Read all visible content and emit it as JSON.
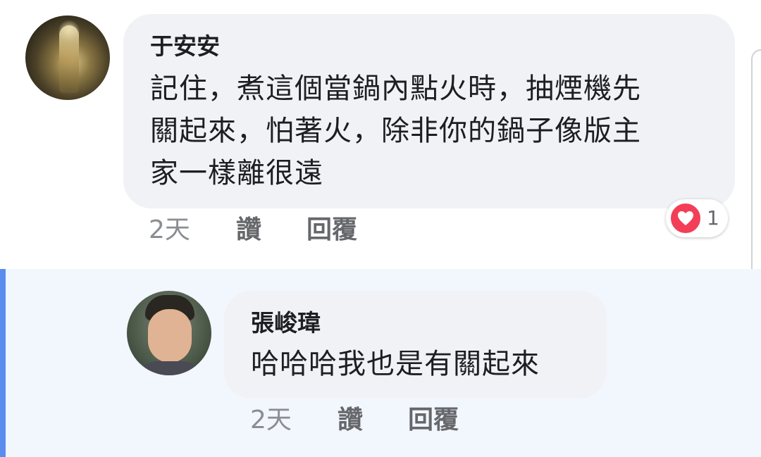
{
  "comments": [
    {
      "author": "于安安",
      "text_lines": [
        "記住，煮這個當鍋內點火時，抽煙機先",
        "關起來，怕著火，除非你的鍋子像版主",
        "家一樣離很遠"
      ],
      "time": "2天",
      "like_label": "讚",
      "reply_label": "回覆",
      "reaction": {
        "icon": "heart-icon",
        "color": "#f33e58",
        "count": "1"
      }
    },
    {
      "author": "張峻瑋",
      "text_lines": [
        "哈哈哈我也是有關起來"
      ],
      "time": "2天",
      "like_label": "讚",
      "reply_label": "回覆"
    }
  ],
  "colors": {
    "bubble": "#f0f2f5",
    "highlight_background": "#f2f6fd",
    "highlight_accent": "#5b8def",
    "meta_text": "#8a8d91"
  }
}
